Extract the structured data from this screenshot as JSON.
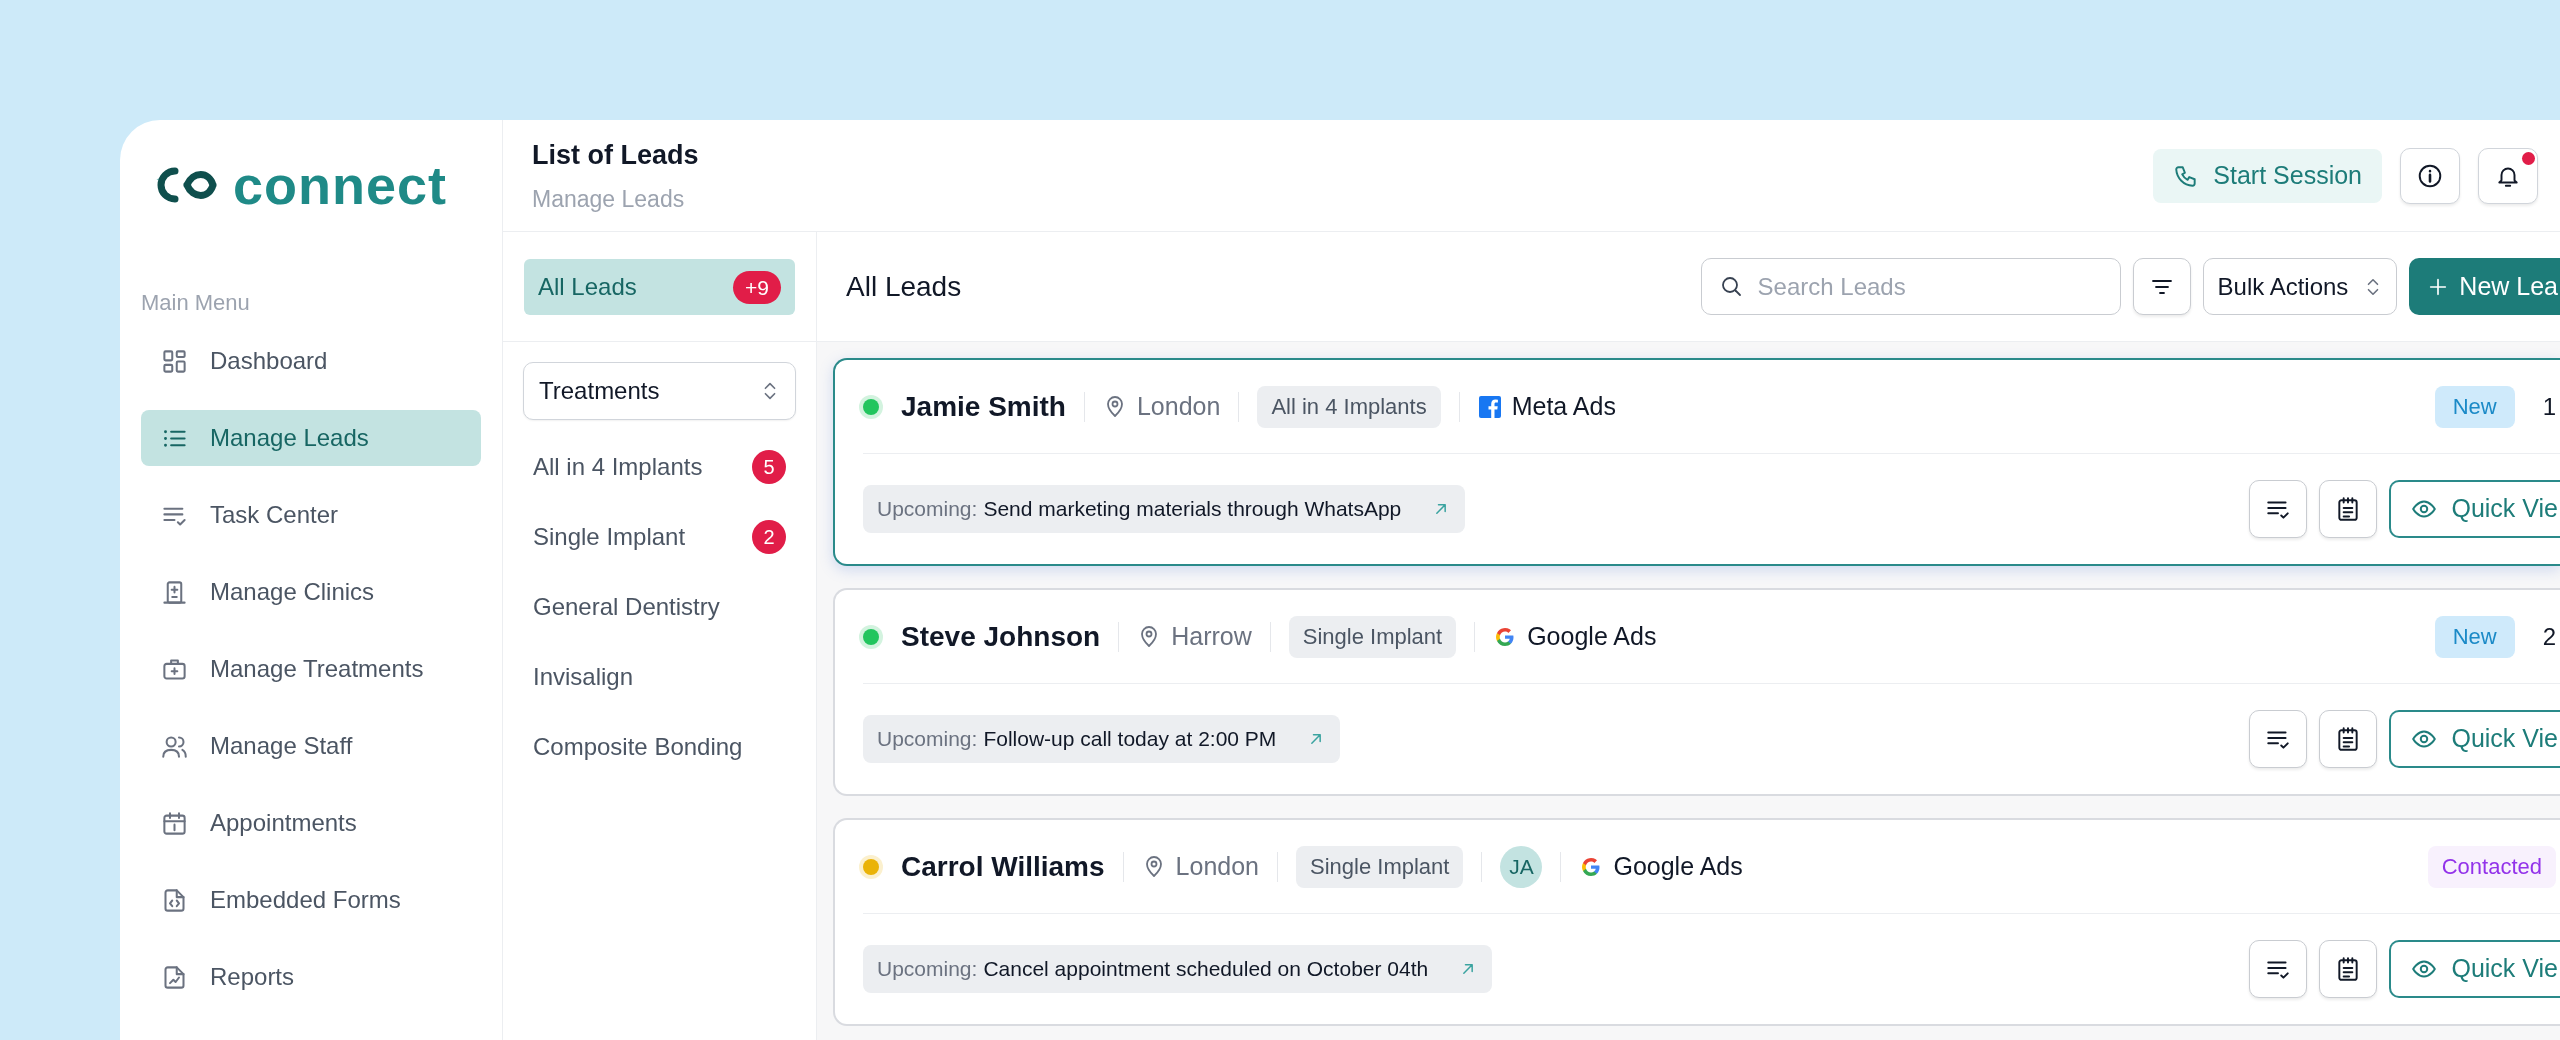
{
  "logo": {
    "text": "connect"
  },
  "sidebar": {
    "heading": "Main Menu",
    "items": [
      {
        "label": "Dashboard",
        "selected": false
      },
      {
        "label": "Manage Leads",
        "selected": true
      },
      {
        "label": "Task Center",
        "selected": false
      },
      {
        "label": "Manage Clinics",
        "selected": false
      },
      {
        "label": "Manage Treatments",
        "selected": false
      },
      {
        "label": "Manage Staff",
        "selected": false
      },
      {
        "label": "Appointments",
        "selected": false
      },
      {
        "label": "Embedded Forms",
        "selected": false
      },
      {
        "label": "Reports",
        "selected": false
      }
    ]
  },
  "header": {
    "title": "List of Leads",
    "subtitle": "Manage Leads",
    "start_session": "Start Session",
    "notifications_unread": true
  },
  "filters": {
    "all": {
      "label": "All Leads",
      "count": "+9",
      "selected": true
    },
    "select": "Treatments",
    "items": [
      {
        "label": "All in 4 Implants",
        "count": "5"
      },
      {
        "label": "Single Implant",
        "count": "2"
      },
      {
        "label": "General Dentistry"
      },
      {
        "label": "Invisalign"
      },
      {
        "label": "Composite Bonding"
      }
    ]
  },
  "main": {
    "title": "All Leads",
    "search": {
      "placeholder": "Search Leads"
    },
    "bulk_actions": "Bulk Actions",
    "new_button": "New Lea"
  },
  "leads": [
    {
      "name": "Jamie Smith",
      "color": "#22c55e",
      "selected": true,
      "location": "London",
      "treatment": "All in 4 Implants",
      "source": {
        "kind": "meta",
        "label": "Meta Ads"
      },
      "status": {
        "kind": "new",
        "label": "New"
      },
      "number": "1",
      "upcoming_label": "Upcoming:",
      "task": "Send marketing materials through WhatsApp",
      "quick_view": "Quick Vie"
    },
    {
      "name": "Steve Johnson",
      "color": "#22c55e",
      "selected": false,
      "location": "Harrow",
      "treatment": "Single Implant",
      "source": {
        "kind": "google",
        "label": "Google Ads"
      },
      "status": {
        "kind": "new",
        "label": "New"
      },
      "number": "2",
      "upcoming_label": "Upcoming:",
      "task": "Follow-up call today at 2:00 PM",
      "quick_view": "Quick Vie"
    },
    {
      "name": "Carrol Williams",
      "color": "#eab308",
      "selected": false,
      "location": "London",
      "treatment": "Single Implant",
      "assignee": "JA",
      "source": {
        "kind": "google",
        "label": "Google Ads"
      },
      "status": {
        "kind": "contacted",
        "label": "Contacted"
      },
      "upcoming_label": "Upcoming:",
      "task": "Cancel appointment scheduled on October 04th",
      "quick_view": "Quick Vie"
    }
  ]
}
